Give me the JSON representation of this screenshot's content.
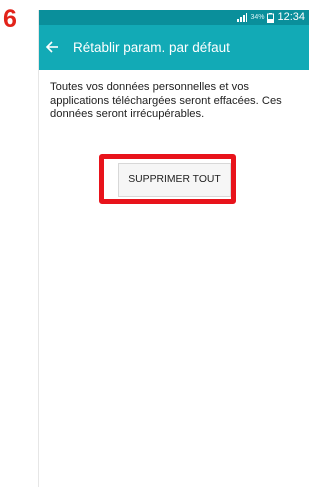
{
  "step_marker": "6",
  "status_bar": {
    "battery_percent": "34%",
    "time": "12:34",
    "signal_icon": "signal-bars-icon",
    "battery_icon": "battery-icon",
    "background_color": "#0a8f9b"
  },
  "app_bar": {
    "back_icon": "arrow-left-icon",
    "title": "Rétablir param. par défaut",
    "background_color": "#12aab6"
  },
  "message": "Toutes vos données personnelles et vos applications téléchargées seront effacées. Ces données seront irrécupérables.",
  "actions": {
    "delete_all_label": "SUPPRIMER TOUT",
    "highlight_color": "#e8131b"
  }
}
